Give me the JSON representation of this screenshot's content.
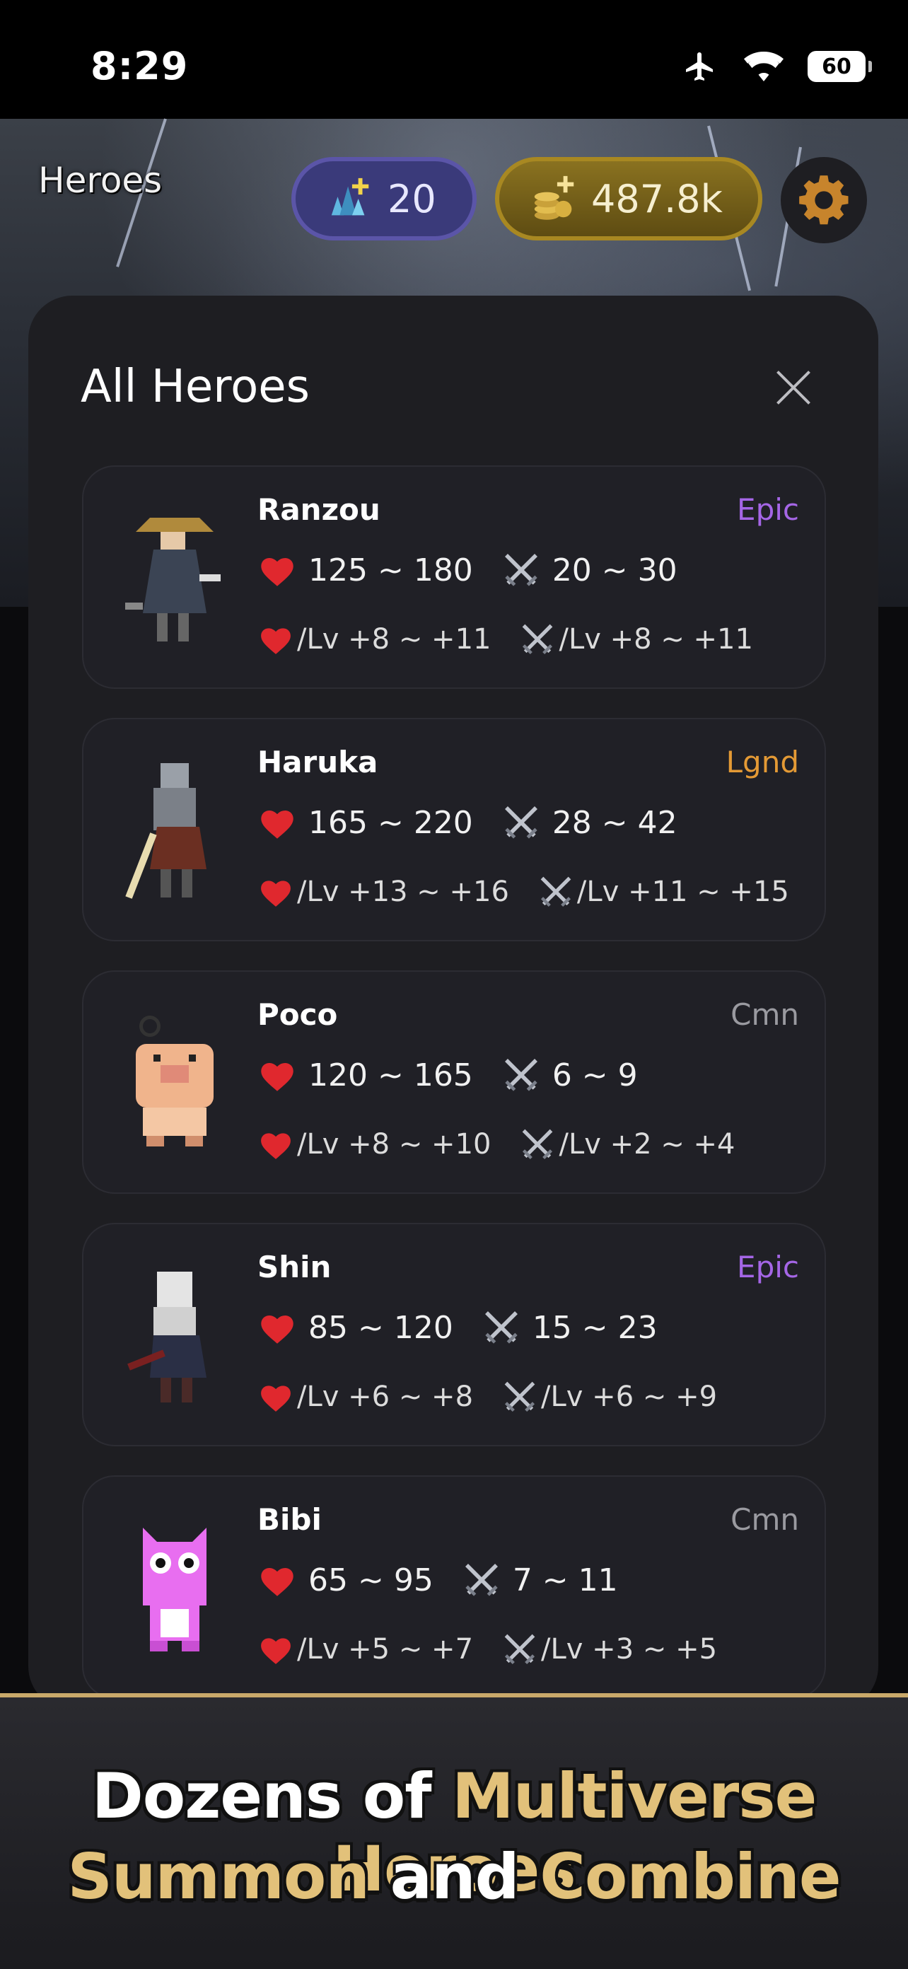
{
  "status_bar": {
    "time": "8:29",
    "battery": "60"
  },
  "header": {
    "title": "Heroes",
    "gems": "20",
    "gold": "487.8k"
  },
  "modal": {
    "title": "All Heroes",
    "heroes": [
      {
        "name": "Ranzou",
        "rarity": "Epic",
        "hp": "125 ~ 180",
        "atk": "20 ~ 30",
        "hp_lv": "/Lv +8 ~ +11",
        "atk_lv": "/Lv +8 ~ +11"
      },
      {
        "name": "Haruka",
        "rarity": "Lgnd",
        "hp": "165 ~ 220",
        "atk": "28 ~ 42",
        "hp_lv": "/Lv +13 ~ +16",
        "atk_lv": "/Lv +11 ~ +15"
      },
      {
        "name": "Poco",
        "rarity": "Cmn",
        "hp": "120 ~ 165",
        "atk": "6 ~ 9",
        "hp_lv": "/Lv +8 ~ +10",
        "atk_lv": "/Lv +2 ~ +4"
      },
      {
        "name": "Shin",
        "rarity": "Epic",
        "hp": "85 ~ 120",
        "atk": "15 ~ 23",
        "hp_lv": "/Lv +6 ~ +8",
        "atk_lv": "/Lv +6 ~ +9"
      },
      {
        "name": "Bibi",
        "rarity": "Cmn",
        "hp": "65 ~ 95",
        "atk": "7 ~ 11",
        "hp_lv": "/Lv +5 ~ +7",
        "atk_lv": "/Lv +3 ~ +5"
      }
    ]
  },
  "banner": {
    "line1_a": "Dozens of ",
    "line1_b": "Multiverse Heroes",
    "line2_a": "Summon",
    "line2_b": " and ",
    "line2_c": "Combine"
  },
  "colors": {
    "epic": "#a566e6",
    "legendary": "#e49a35",
    "common": "#9a9aa0",
    "banner_gold": "#e2c17a"
  }
}
